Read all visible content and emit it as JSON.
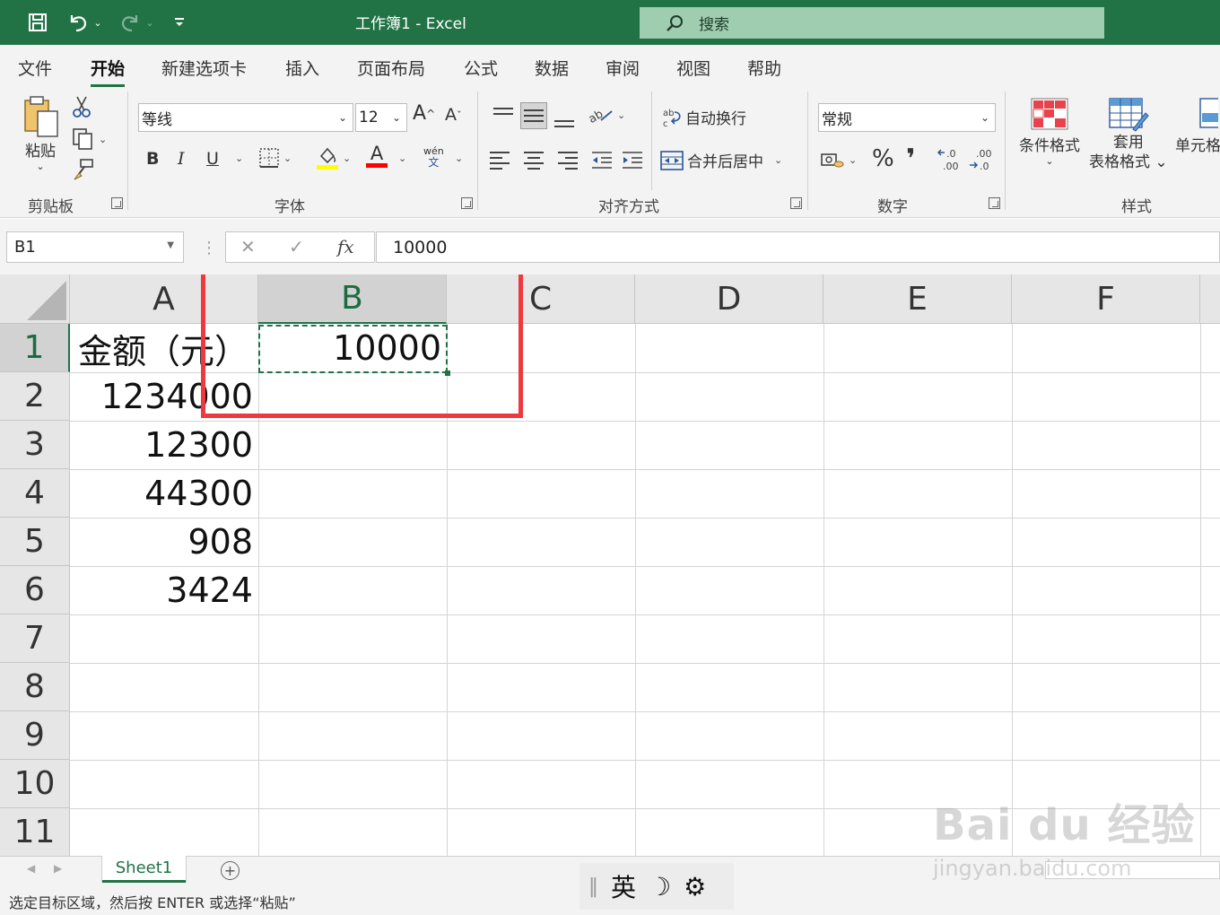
{
  "titlebar": {
    "title": "工作簿1  -  Excel",
    "search_label": "搜索"
  },
  "menu": {
    "tabs": [
      "文件",
      "开始",
      "新建选项卡",
      "插入",
      "页面布局",
      "公式",
      "数据",
      "审阅",
      "视图",
      "帮助"
    ],
    "active": "开始"
  },
  "ribbon": {
    "clipboard": {
      "paste_label": "粘贴",
      "group_label": "剪贴板"
    },
    "font": {
      "font_name": "等线",
      "font_size": "12",
      "bold": "B",
      "italic": "I",
      "underline": "U",
      "font_color_glyph": "A",
      "phonetic_top": "wén",
      "phonetic_bottom": "文",
      "group_label": "字体",
      "grow": "A",
      "shrink": "A"
    },
    "alignment": {
      "wrap_text": "自动换行",
      "merge_center": "合并后居中",
      "group_label": "对齐方式"
    },
    "number": {
      "format": "常规",
      "percent": "%",
      "comma": "❜",
      "group_label": "数字"
    },
    "styles": {
      "conditional": "条件格式",
      "table_top": "套用",
      "table_bottom": "表格格式",
      "cell_styles": "单元格",
      "group_label": "样式"
    },
    "colors": {
      "highlight": "#ffff00",
      "font_color": "#ff0000"
    }
  },
  "formula_bar": {
    "name_box": "B1",
    "fx": "fx",
    "value": "10000"
  },
  "grid": {
    "columns": [
      "A",
      "B",
      "C",
      "D",
      "E",
      "F"
    ],
    "rows": [
      "1",
      "2",
      "3",
      "4",
      "5",
      "6",
      "7",
      "8",
      "9",
      "10",
      "11"
    ],
    "cells": {
      "A1": "金额（元）",
      "B1": "10000",
      "A2": "1234000",
      "A3": "12300",
      "A4": "44300",
      "A5": "908",
      "A6": "3424"
    },
    "selected_cell": "B1"
  },
  "sheet_tabs": {
    "active": "Sheet1",
    "add": "+"
  },
  "status": {
    "message": "选定目标区域，然后按 ENTER 或选择“粘贴”"
  },
  "ime": {
    "language": "英",
    "moon": "☽",
    "gear": "⚙"
  },
  "watermark": {
    "brand": "Bai du 经验",
    "url": "jingyan.baidu.com"
  },
  "colors": {
    "accent": "#217346",
    "highlight_box": "#ee3a3f"
  }
}
